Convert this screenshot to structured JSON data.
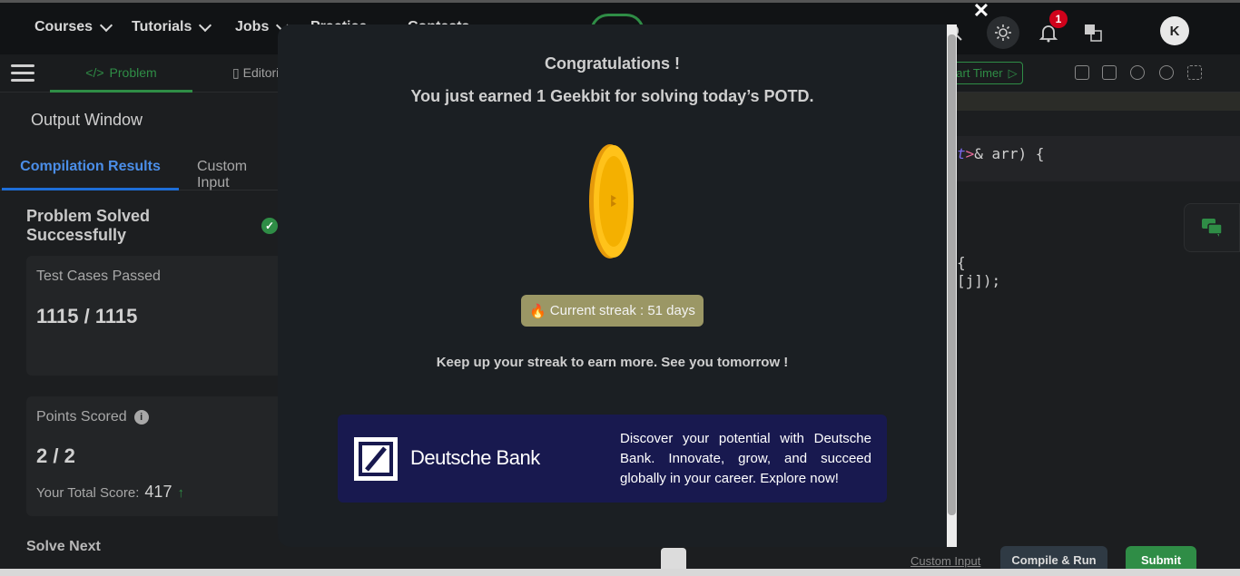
{
  "nav": {
    "items": [
      {
        "label": "Courses"
      },
      {
        "label": "Tutorials"
      },
      {
        "label": "Jobs"
      },
      {
        "label": "Practice"
      },
      {
        "label": "Contests"
      }
    ],
    "notification_count": "1",
    "avatar_initial": "K"
  },
  "toolbar": {
    "problem_tab": "Problem",
    "editorial_tab": "Editorial",
    "timer_label": "Start Timer"
  },
  "output": {
    "title": "Output Window",
    "tabs": {
      "compilation": "Compilation Results",
      "custom": "Custom Input"
    },
    "status": "Problem Solved Successfully",
    "test_cases_label": "Test Cases Passed",
    "test_cases_value": "1115 / 1115",
    "points_label": "Points Scored",
    "points_value": "2 / 2",
    "total_score_label": "Your Total Score:",
    "total_score_value": "417",
    "solve_next": "Solve Next"
  },
  "editor": {
    "line1_type": "t",
    "line1_rest": "& arr) {",
    "line2": "{",
    "line3": "[j]);"
  },
  "bottom": {
    "custom_input": "Custom Input",
    "compile_run": "Compile & Run",
    "submit": "Submit"
  },
  "modal": {
    "close": "✕",
    "title": "Congratulations !",
    "subtitle": "You just earned 1 Geekbit for solving today’s POTD.",
    "streak": "Current streak : 51 days",
    "keep_up": "Keep up your streak to earn more. See you tomorrow !",
    "ad": {
      "brand": "Deutsche Bank",
      "text": "Discover your potential with Deutsche Bank. Innovate, grow, and succeed globally in your career. Explore now!"
    }
  },
  "colors": {
    "accent_green": "#2f8d46",
    "link_blue": "#4b8ee8",
    "ad_background": "#18194f",
    "streak_background": "#9b9765"
  },
  "icons": [
    "search-icon",
    "sun-icon",
    "bell-icon",
    "translate-icon",
    "hamburger-icon",
    "code-icon",
    "document-icon",
    "play-icon",
    "copy-icon",
    "export-icon",
    "gear-icon",
    "refresh-icon",
    "fullscreen-icon",
    "check-icon",
    "info-icon",
    "arrow-up-icon",
    "chat-icon",
    "lightbulb-icon",
    "coin-icon",
    "flame-icon"
  ]
}
